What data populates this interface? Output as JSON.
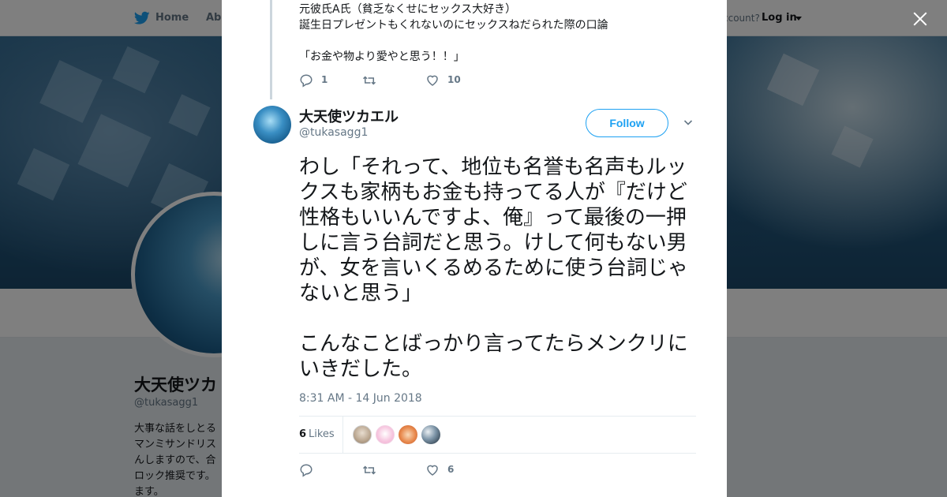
{
  "background_page": {
    "nav": {
      "home_label": "Home",
      "about_label": "Abo",
      "account_prompt": "ccount?",
      "login_label": "Log in"
    },
    "profile_name": "大天使ツカ",
    "profile_handle": "@tukasagg1",
    "bio_lines": [
      "大事な話をしとる",
      "マンミサンドリス",
      "んしますので、合",
      "ロック推奨です。",
      "ます。"
    ]
  },
  "modal": {
    "previous_tweet": {
      "text": "元彼氏A氏（貧乏なくせにセックス大好き）\n誕生日プレゼントもくれないのにセックスねだられた際の口論\n\n「お金や物より愛やと思う！！」",
      "reply_count": "1",
      "retweet_count": "",
      "like_count": "10"
    },
    "tweet": {
      "author_name": "大天使ツカエル",
      "author_handle": "@tukasagg1",
      "follow_label": "Follow",
      "text": "わし「それって、地位も名誉も名声もルックスも家柄もお金も持ってる人が『だけど性格もいいんですよ、俺』って最後の一押しに言う台詞だと思う。けして何もない男が、女を言いくるめるために使う台詞じゃないと思う」\n\nこんなことばっかり言ってたらメンクリにいきだした。",
      "timestamp": "8:31 AM - 14 Jun 2018",
      "likes_count": "6",
      "likes_label": "Likes",
      "reply_count": "",
      "retweet_count": "",
      "like_count": "6"
    }
  },
  "colors": {
    "accent": "#1da1f2",
    "text": "#14171a",
    "muted": "#657786",
    "border": "#e6ecf0"
  },
  "icons": [
    "twitter-bird-icon",
    "close-icon",
    "reply-icon",
    "retweet-icon",
    "like-icon",
    "chevron-down-icon"
  ]
}
